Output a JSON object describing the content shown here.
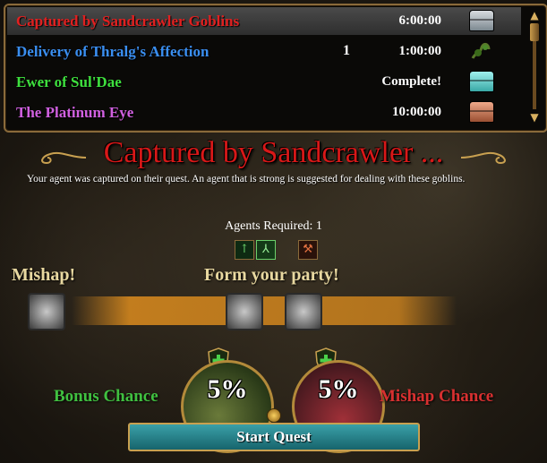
{
  "quests": [
    {
      "name": "Captured by Sandcrawler Goblins",
      "count": "",
      "time": "6:00:00",
      "color": "#e02020",
      "chest": "silver-chest-icon",
      "selected": true
    },
    {
      "name": "Delivery of Thralg's Affection",
      "count": "1",
      "time": "1:00:00",
      "color": "#3a8ef0",
      "chest": "vine-icon",
      "selected": false
    },
    {
      "name": "Ewer of Sul'Dae",
      "count": "",
      "time": "Complete!",
      "color": "#3ee03e",
      "chest": "teal-chest-icon",
      "selected": false
    },
    {
      "name": "The Platinum Eye",
      "count": "",
      "time": "10:00:00",
      "color": "#d060e0",
      "chest": "copper-chest-icon",
      "selected": false
    }
  ],
  "detail": {
    "title": "Captured by Sandcrawler ...",
    "description": "Your agent was captured on their quest. An agent that is strong is suggested for dealing with these goblins.",
    "agents_required": "Agents Required: 1",
    "mishap_label": "Mishap!",
    "party_label": "Form your party!",
    "bonus_label": "Bonus Chance",
    "bonus_value": "5%",
    "mishap_chance_label": "Mishap Chance",
    "mishap_value": "5%",
    "start_button": "Start Quest"
  },
  "colors": {
    "title_red": "#d81818",
    "bonus_green": "#40c040",
    "mishap_red": "#d83030",
    "button_teal": "#17646c"
  }
}
